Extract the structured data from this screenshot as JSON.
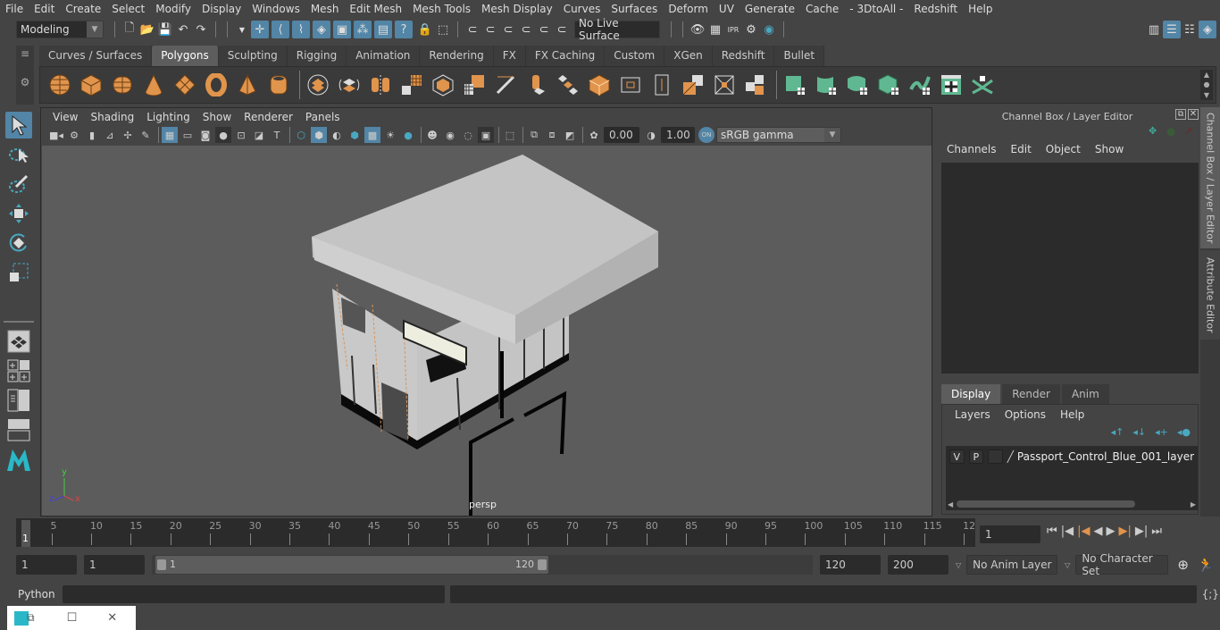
{
  "menubar": [
    "File",
    "Edit",
    "Create",
    "Select",
    "Modify",
    "Display",
    "Windows",
    "Mesh",
    "Edit Mesh",
    "Mesh Tools",
    "Mesh Display",
    "Curves",
    "Surfaces",
    "Deform",
    "UV",
    "Generate",
    "Cache",
    "- 3DtoAll -",
    "Redshift",
    "Help"
  ],
  "status_line": {
    "workspace": "Modeling",
    "live_surface": "No Live Surface"
  },
  "shelf": {
    "tabs": [
      "Curves / Surfaces",
      "Polygons",
      "Sculpting",
      "Rigging",
      "Animation",
      "Rendering",
      "FX",
      "FX Caching",
      "Custom",
      "XGen",
      "Redshift",
      "Bullet"
    ],
    "active_tab": "Polygons"
  },
  "viewport": {
    "menu": [
      "View",
      "Shading",
      "Lighting",
      "Show",
      "Renderer",
      "Panels"
    ],
    "exposure": "0.00",
    "gamma": "1.00",
    "color_space": "sRGB gamma",
    "camera_label": "persp",
    "axis": {
      "x": "x",
      "y": "y",
      "z": "z"
    }
  },
  "channel_box": {
    "title": "Channel Box / Layer Editor",
    "menu": [
      "Channels",
      "Edit",
      "Object",
      "Show"
    ]
  },
  "layer_editor": {
    "tabs": [
      "Display",
      "Render",
      "Anim"
    ],
    "active_tab": "Display",
    "menu": [
      "Layers",
      "Options",
      "Help"
    ],
    "layers": [
      {
        "v": "V",
        "p": "P",
        "name": "Passport_Control_Blue_001_layer"
      }
    ]
  },
  "side_tabs": [
    "Channel Box / Layer Editor",
    "Attribute Editor"
  ],
  "timeline": {
    "ticks": [
      "5",
      "10",
      "15",
      "20",
      "25",
      "30",
      "35",
      "40",
      "45",
      "50",
      "55",
      "60",
      "65",
      "70",
      "75",
      "80",
      "85",
      "90",
      "95",
      "100",
      "105",
      "110",
      "115",
      "12"
    ],
    "current_frame_marker": "1",
    "current_frame": "1"
  },
  "range": {
    "start": "1",
    "playback_start": "1",
    "slider_start": "1",
    "slider_end": "120",
    "playback_end": "120",
    "end": "200",
    "anim_layer": "No Anim Layer",
    "character_set": "No Character Set"
  },
  "command_line": {
    "language": "Python",
    "value": ""
  }
}
